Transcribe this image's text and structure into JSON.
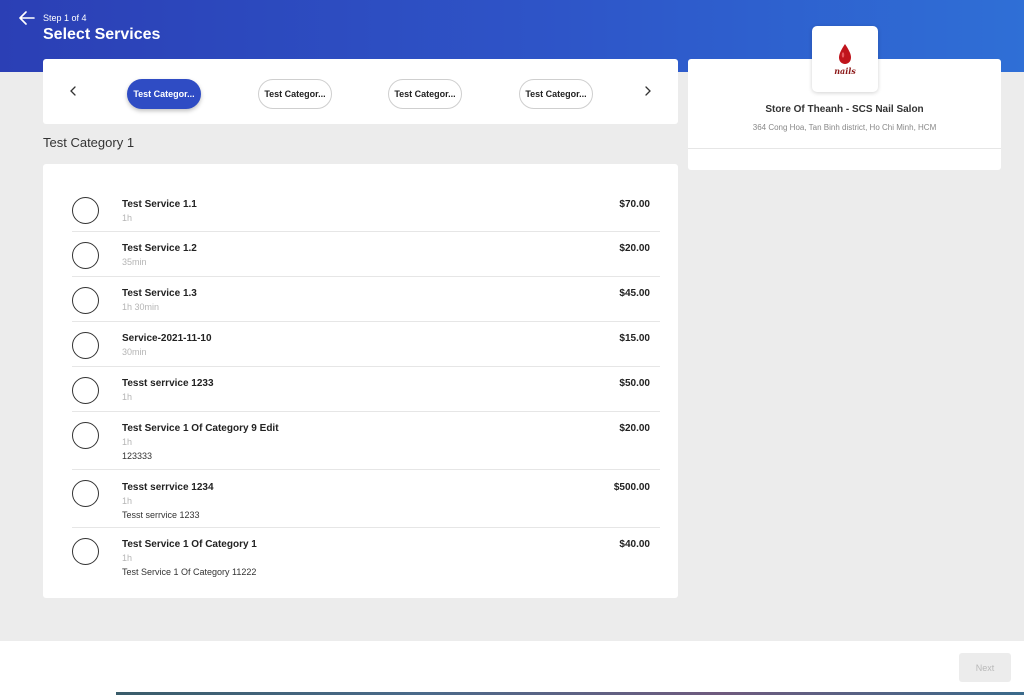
{
  "header": {
    "step": "Step 1 of 4",
    "title": "Select Services"
  },
  "categories": [
    {
      "label": "Test Categor...",
      "active": true
    },
    {
      "label": "Test Categor...",
      "active": false
    },
    {
      "label": "Test Categor...",
      "active": false
    },
    {
      "label": "Test Categor...",
      "active": false
    }
  ],
  "category_heading": "Test Category 1",
  "services": [
    {
      "name": "Test Service 1.1",
      "duration": "1h",
      "description": "",
      "price": "$70.00"
    },
    {
      "name": "Test Service 1.2",
      "duration": "35min",
      "description": "",
      "price": "$20.00"
    },
    {
      "name": "Test Service 1.3",
      "duration": "1h 30min",
      "description": "",
      "price": "$45.00"
    },
    {
      "name": "Service-2021-11-10",
      "duration": "30min",
      "description": "",
      "price": "$15.00"
    },
    {
      "name": "Tesst serrvice 1233",
      "duration": "1h",
      "description": "",
      "price": "$50.00"
    },
    {
      "name": "Test Service 1 Of Category 9 Edit",
      "duration": "1h",
      "description": "123333",
      "price": "$20.00"
    },
    {
      "name": "Tesst serrvice 1234",
      "duration": "1h",
      "description": "Tesst serrvice 1233",
      "price": "$500.00"
    },
    {
      "name": "Test Service 1 Of Category 1",
      "duration": "1h",
      "description": "Test Service 1 Of Category 11222",
      "price": "$40.00"
    }
  ],
  "store": {
    "logo_text": "nails",
    "name": "Store Of Theanh - SCS Nail Salon",
    "address": "364 Cong Hoa, Tan Binh district, Ho Chi Minh, HCM"
  },
  "footer": {
    "next_label": "Next"
  },
  "icons": {
    "back": "arrow-left-icon",
    "prev": "chevron-left-icon",
    "next": "chevron-right-icon",
    "logo": "nail-drop-icon"
  },
  "colors": {
    "accent": "#2f4cc4",
    "header_start": "#2b3fb5",
    "header_end": "#2f6fd6",
    "logo_red": "#c0141c"
  }
}
